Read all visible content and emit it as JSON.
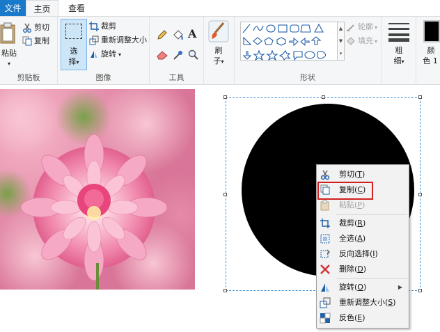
{
  "tabs": {
    "file": "文件",
    "home": "主页",
    "view": "查看"
  },
  "ribbon": {
    "clipboard": {
      "paste": "粘贴",
      "cut": "剪切",
      "copy": "复制",
      "group_label": "剪贴板"
    },
    "image": {
      "select_top": "选",
      "select_bottom": "择",
      "crop": "裁剪",
      "resize": "重新调整大小",
      "rotate": "旋转",
      "group_label": "图像"
    },
    "tools": {
      "group_label": "工具"
    },
    "brushes": {
      "label_top": "刷",
      "label_bottom": "子"
    },
    "shapes": {
      "outline": "轮廓",
      "fill": "填充",
      "group_label": "形状"
    },
    "size": {
      "label_top": "粗",
      "label_bottom": "细"
    },
    "colors": {
      "label_top": "颜",
      "label_bottom": "色 1"
    }
  },
  "context_menu": {
    "items": [
      {
        "label": "剪切",
        "key": "T",
        "icon": "scissors-icon",
        "disabled": false
      },
      {
        "label": "复制",
        "key": "C",
        "icon": "copy-icon",
        "disabled": false
      },
      {
        "label": "粘贴",
        "key": "P",
        "icon": "paste-icon",
        "disabled": true
      },
      {
        "label": "裁剪",
        "key": "R",
        "icon": "crop-icon",
        "disabled": false
      },
      {
        "label": "全选",
        "key": "A",
        "icon": "select-all-icon",
        "disabled": false
      },
      {
        "label": "反向选择",
        "key": "I",
        "icon": "invert-selection-icon",
        "disabled": false
      },
      {
        "label": "删除",
        "key": "D",
        "icon": "delete-icon",
        "disabled": false
      },
      {
        "label": "旋转",
        "key": "O",
        "icon": "rotate-icon",
        "disabled": false
      },
      {
        "label": "重新调整大小",
        "key": "S",
        "icon": "resize-icon",
        "disabled": false
      },
      {
        "label": "反色",
        "key": "E",
        "icon": "invert-color-icon",
        "disabled": false
      }
    ]
  },
  "colors": {
    "accent": "#1979ca",
    "ribbon_bg": "#f5f6f7",
    "highlight": "#d02020",
    "shape": "#000000"
  }
}
